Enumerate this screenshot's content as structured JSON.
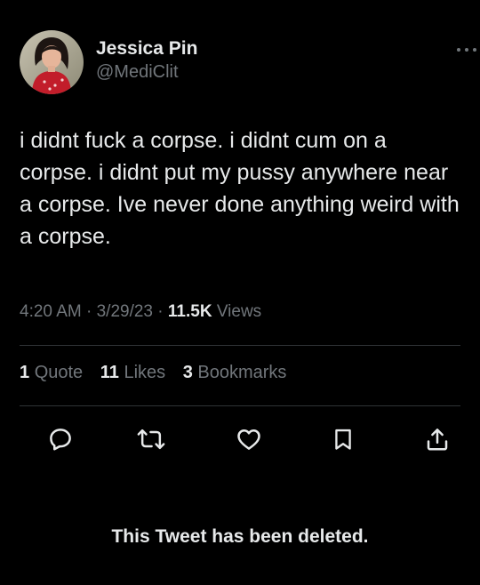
{
  "author": {
    "display_name": "Jessica Pin",
    "handle": "@MediClit"
  },
  "tweet": {
    "text": "i didnt fuck a corpse. i didnt cum on a corpse. i didnt put my pussy anywhere near a corpse. Ive never done anything weird with a corpse.",
    "time": "4:20 AM",
    "date": "3/29/23",
    "separator": "·",
    "views_count": "11.5K",
    "views_label": "Views"
  },
  "stats": {
    "quotes_count": "1",
    "quotes_label": "Quote",
    "likes_count": "11",
    "likes_label": "Likes",
    "bookmarks_count": "3",
    "bookmarks_label": "Bookmarks"
  },
  "actions": [
    "reply-icon",
    "retweet-icon",
    "like-icon",
    "bookmark-icon",
    "share-icon"
  ],
  "banner": {
    "deleted_text": "This Tweet has been deleted."
  },
  "colors": {
    "background": "#000000",
    "primary_text": "#e7e9ea",
    "secondary_text": "#71767b",
    "divider": "#2f3336"
  }
}
